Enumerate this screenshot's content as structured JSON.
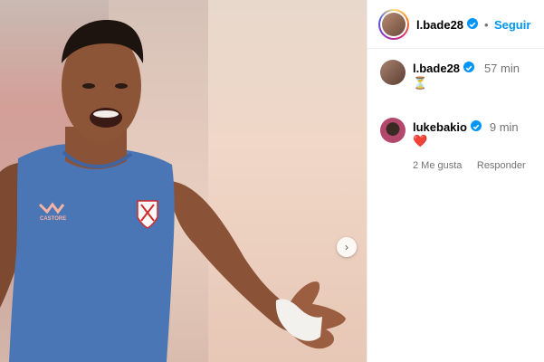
{
  "header": {
    "username": "l.bade28",
    "dot": "•",
    "follow_label": "Seguir"
  },
  "comments": [
    {
      "username": "l.bade28",
      "time": "57 min",
      "emoji": "⏳"
    },
    {
      "username": "lukebakio",
      "time": "9 min",
      "emoji": "❤️",
      "likes_label": "2 Me gusta",
      "reply_label": "Responder"
    }
  ],
  "media": {
    "logo_text": "CASTORE",
    "next_icon": "chevron-right-icon"
  },
  "colors": {
    "accent": "#0095f6",
    "jersey": "#4b76b6",
    "heart": "#ed4956",
    "muted": "#737373"
  }
}
